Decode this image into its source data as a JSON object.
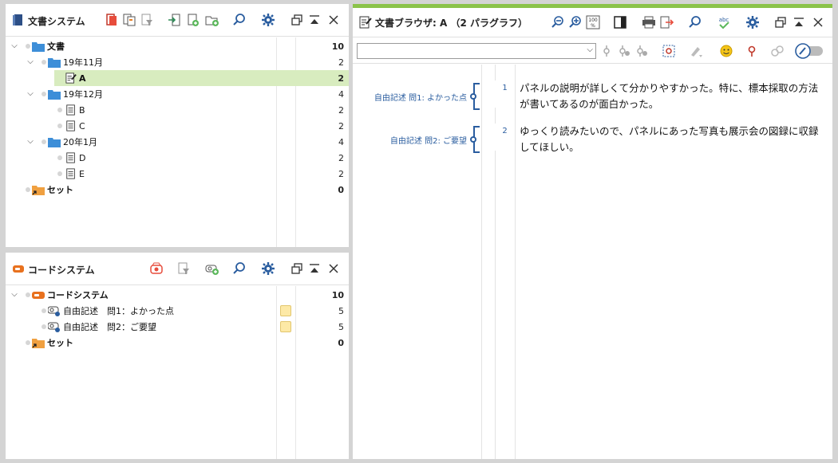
{
  "doc_system": {
    "title": "文書システム",
    "rows": [
      {
        "label": "文書",
        "count": "10"
      },
      {
        "label": "19年11月",
        "count": "2"
      },
      {
        "label": "A",
        "count": "2"
      },
      {
        "label": "19年12月",
        "count": "4"
      },
      {
        "label": "B",
        "count": "2"
      },
      {
        "label": "C",
        "count": "2"
      },
      {
        "label": "20年1月",
        "count": "4"
      },
      {
        "label": "D",
        "count": "2"
      },
      {
        "label": "E",
        "count": "2"
      },
      {
        "label": "セット",
        "count": "0"
      }
    ]
  },
  "code_system": {
    "title": "コードシステム",
    "rows": [
      {
        "label": "コードシステム",
        "count": "10"
      },
      {
        "label": "自由記述　問1：よかった点",
        "count": "5"
      },
      {
        "label": "自由記述　問2：ご要望",
        "count": "5"
      },
      {
        "label": "セット",
        "count": "0"
      }
    ]
  },
  "doc_browser": {
    "title": "文書ブラウザ: A （2 パラグラフ）",
    "search_value": "",
    "paragraphs": [
      {
        "num": "1",
        "code": "自由記述  問1: よかった点",
        "text": "パネルの説明が詳しくて分かりやすかった。特に、標本採取の方法が書いてあるのが面白かった。"
      },
      {
        "num": "2",
        "code": "自由記述  問2: ご要望",
        "text": "ゆっくり読みたいので、パネルにあった写真も展示会の図録に収録してほしい。"
      }
    ]
  },
  "colors": {
    "accent_green": "#8bc34a",
    "selected_row": "#d8ecbf",
    "folder_blue": "#3d8ed8",
    "code_blue": "#2a5d9f",
    "set_orange": "#f0a040"
  }
}
